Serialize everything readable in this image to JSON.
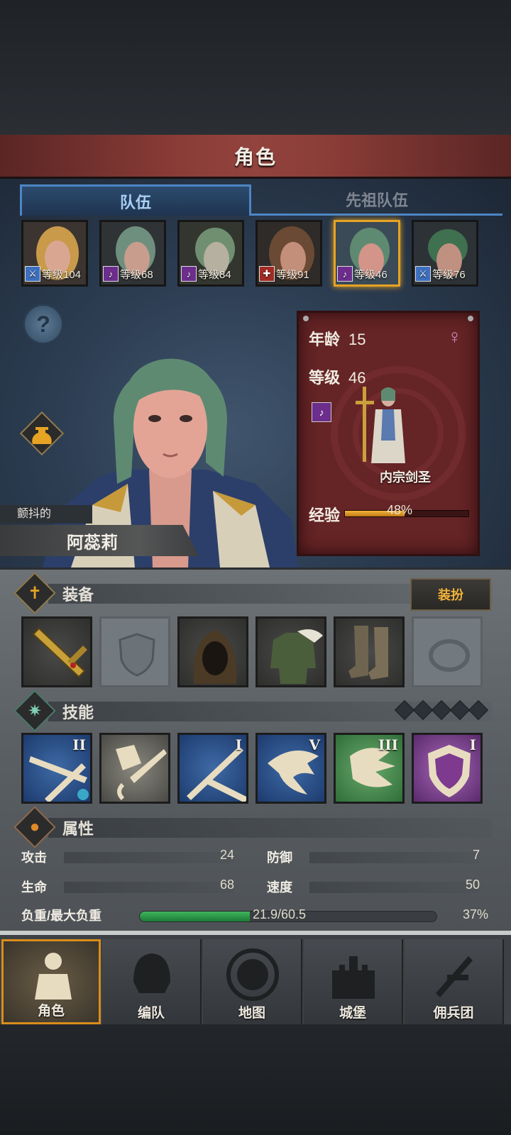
{
  "header": {
    "title": "角色"
  },
  "tabs": [
    {
      "label": "队伍",
      "active": true
    },
    {
      "label": "先祖队伍",
      "active": false
    }
  ],
  "roster": [
    {
      "level_text": "等级104",
      "class_color": "#3d6fbf",
      "hair": "#c89a4a",
      "selected": false
    },
    {
      "level_text": "等级68",
      "class_color": "#6c2d8c",
      "hair": "#6f8f7e",
      "selected": false
    },
    {
      "level_text": "等级84",
      "class_color": "#6c2d8c",
      "hair": "#6f8f70",
      "selected": false
    },
    {
      "level_text": "等级91",
      "class_color": "#a22a24",
      "hair": "#6a4a34",
      "selected": false
    },
    {
      "level_text": "等级46",
      "class_color": "#6c2d8c",
      "hair": "#5f8a72",
      "selected": true
    },
    {
      "level_text": "等级76",
      "class_color": "#3d6fbf",
      "hair": "#3f7050",
      "selected": false
    }
  ],
  "character": {
    "epithet": "颤抖的",
    "name": "阿蕊莉",
    "age_label": "年龄",
    "age": "15",
    "level_label": "等级",
    "level": "46",
    "gender_symbol": "♀",
    "class_name": "内宗剑圣",
    "exp_label": "经验",
    "exp_percent_text": "48%",
    "exp_fraction": 0.48
  },
  "equipment": {
    "title": "装备",
    "dress_button": "装扮",
    "slots": [
      "golden-sword",
      "empty-shield",
      "hood",
      "tunic",
      "boots",
      "empty-ring"
    ]
  },
  "skills": {
    "title": "技能",
    "pip_count": 5,
    "items": [
      {
        "icon": "twin-blades-icon",
        "rank": "II",
        "color": "#2a5592",
        "badge": "2"
      },
      {
        "icon": "diamond-sword-icon",
        "rank": "",
        "color": "#4a4a46",
        "badge": ""
      },
      {
        "icon": "cross-blades-icon",
        "rank": "I",
        "color": "#2a5592",
        "badge": ""
      },
      {
        "icon": "dash-icon",
        "rank": "V",
        "color": "#2a5592",
        "badge": ""
      },
      {
        "icon": "claw-icon",
        "rank": "III",
        "color": "#3f8a4a",
        "badge": ""
      },
      {
        "icon": "shield-icon",
        "rank": "I",
        "color": "#7d3a8f",
        "badge": ""
      }
    ]
  },
  "attributes": {
    "title": "属性",
    "attack_label": "攻击",
    "attack": "24",
    "defense_label": "防御",
    "defense": "7",
    "hp_label": "生命",
    "hp": "68",
    "speed_label": "速度",
    "speed": "50",
    "load_label": "负重/最大负重",
    "load_text": "21.9/60.5",
    "load_percent_text": "37%",
    "load_fraction": 0.37
  },
  "nav": [
    {
      "label": "角色",
      "active": true
    },
    {
      "label": "编队",
      "active": false
    },
    {
      "label": "地图",
      "active": false
    },
    {
      "label": "城堡",
      "active": false
    },
    {
      "label": "佣兵团",
      "active": false
    }
  ]
}
